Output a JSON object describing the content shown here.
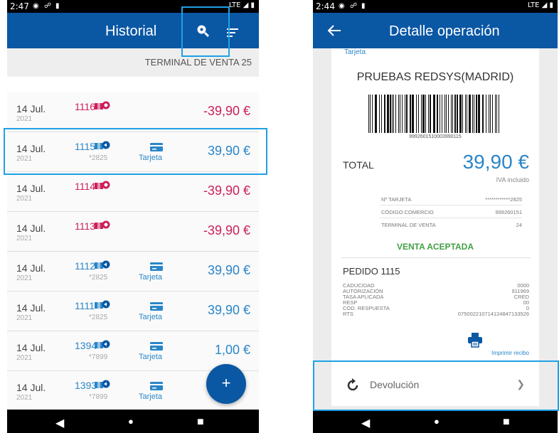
{
  "left": {
    "status_time": "2:47",
    "status_lte": "LTE",
    "title": "Historial",
    "terminal": "TERMINAL DE VENTA 25",
    "rows": [
      {
        "date": "14 Jul.",
        "year": "2021",
        "num": "1116",
        "card4": "",
        "type_label": "",
        "amount": "-39,90 €",
        "kind": "neg"
      },
      {
        "date": "14 Jul.",
        "year": "2021",
        "num": "1115",
        "card4": "*2825",
        "type_label": "Tarjeta",
        "amount": "39,90 €",
        "kind": "pos"
      },
      {
        "date": "14 Jul.",
        "year": "2021",
        "num": "1114",
        "card4": "",
        "type_label": "",
        "amount": "-39,90 €",
        "kind": "neg"
      },
      {
        "date": "14 Jul.",
        "year": "2021",
        "num": "1113",
        "card4": "",
        "type_label": "",
        "amount": "-39,90 €",
        "kind": "neg"
      },
      {
        "date": "14 Jul.",
        "year": "2021",
        "num": "1112",
        "card4": "*2825",
        "type_label": "Tarjeta",
        "amount": "39,90 €",
        "kind": "pos"
      },
      {
        "date": "14 Jul.",
        "year": "2021",
        "num": "1111",
        "card4": "*2825",
        "type_label": "Tarjeta",
        "amount": "39,90 €",
        "kind": "pos"
      },
      {
        "date": "14 Jul.",
        "year": "2021",
        "num": "1394",
        "card4": "*7899",
        "type_label": "Tarjeta",
        "amount": "1,00 €",
        "kind": "pos"
      },
      {
        "date": "14 Jul.",
        "year": "2021",
        "num": "1393",
        "card4": "*7899",
        "type_label": "Tarjeta",
        "amount": "",
        "kind": "pos"
      }
    ],
    "fab": "+"
  },
  "right": {
    "status_time": "2:44",
    "status_lte": "LTE",
    "title": "Detalle operación",
    "tarjeta_top": "Tarjeta",
    "merchant": "PRUEBAS REDSYS(MADRID)",
    "barcode_number": "9992601510003990115",
    "total_label": "TOTAL",
    "total_value": "39,90 €",
    "iva": "IVA incluido",
    "info": [
      {
        "k": "Nº TARJETA",
        "v": "************2825"
      },
      {
        "k": "CÓDIGO COMERCIO",
        "v": "999260151"
      },
      {
        "k": "TERMINAL DE VENTA",
        "v": "24"
      }
    ],
    "venta_status": "VENTA ACEPTADA",
    "pedido": "PEDIDO 1115",
    "details": [
      {
        "k": "CADUCIDAD",
        "v": "0000"
      },
      {
        "k": "AUTORIZACIÓN",
        "v": "911969"
      },
      {
        "k": "TASA APLICADA",
        "v": "CRED"
      },
      {
        "k": "RESP",
        "v": "00"
      },
      {
        "k": "COD. RESPUESTA",
        "v": "0"
      },
      {
        "k": "RTS",
        "v": "07500221071412484713352​6"
      }
    ],
    "print_label": "Imprimir recibo",
    "devolucion": "Devolución"
  },
  "colors": {
    "primary": "#0a57a4",
    "positive": "#2a86c8",
    "negative": "#cc1f5c",
    "accepted": "#43a047",
    "highlight": "#1ea1e5"
  }
}
